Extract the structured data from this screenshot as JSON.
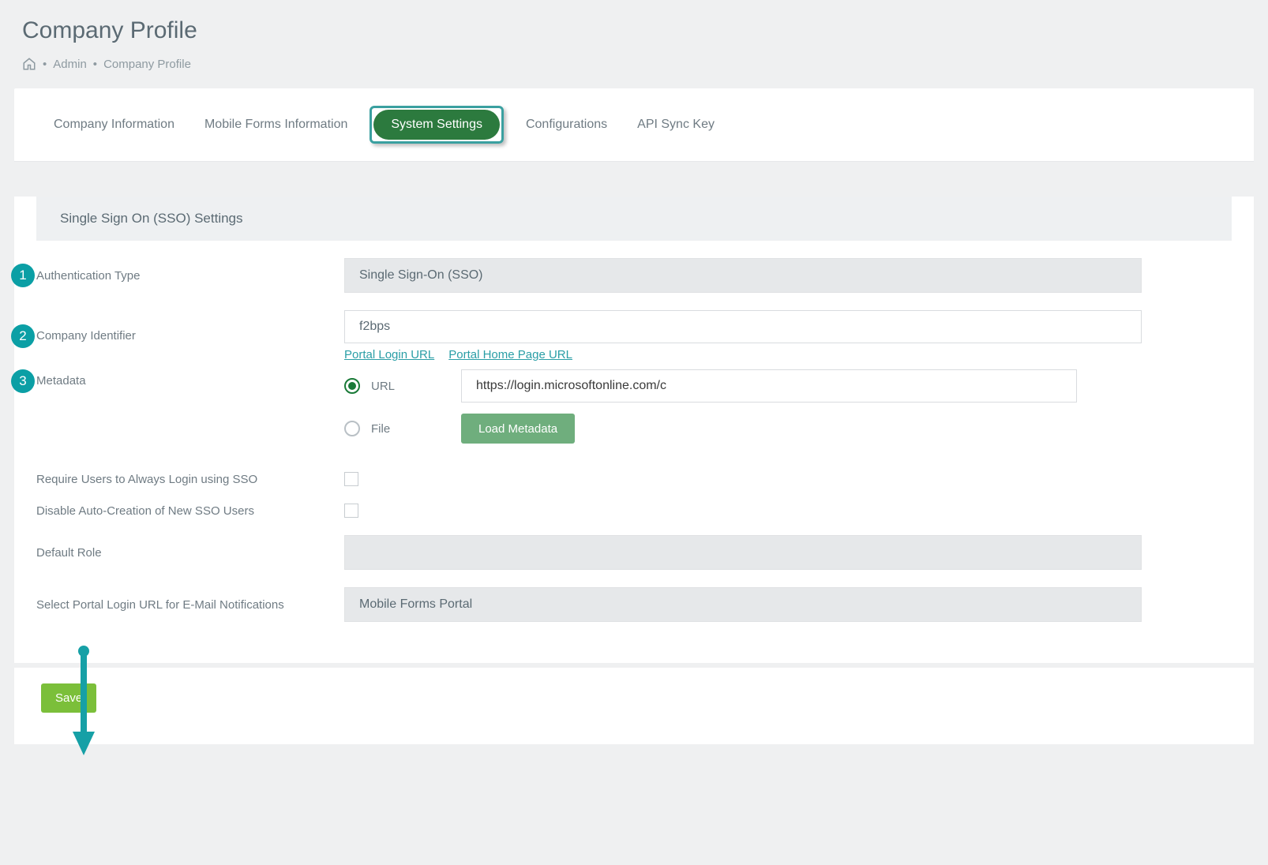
{
  "page": {
    "title": "Company Profile"
  },
  "breadcrumb": {
    "admin": "Admin",
    "current": "Company Profile"
  },
  "tabs": {
    "company_info": "Company Information",
    "mobile_forms_info": "Mobile Forms Information",
    "system_settings": "System Settings",
    "configurations": "Configurations",
    "api_sync_key": "API Sync Key"
  },
  "section": {
    "title": "Single Sign On (SSO) Settings"
  },
  "fields": {
    "auth_type_label": "Authentication Type",
    "auth_type_value": "Single Sign-On (SSO)",
    "company_identifier_label": "Company Identifier",
    "company_identifier_value": "f2bps",
    "portal_login_url_link": "Portal Login URL",
    "portal_home_url_link": "Portal Home Page URL",
    "metadata_label": "Metadata",
    "metadata_option_url": "URL",
    "metadata_option_file": "File",
    "metadata_url_value": "https://login.microsoftonline.com/c",
    "load_metadata_btn": "Load Metadata",
    "require_sso_label": "Require Users to Always Login using SSO",
    "disable_autocreate_label": "Disable Auto-Creation of New SSO Users",
    "default_role_label": "Default Role",
    "default_role_value": "",
    "select_portal_login_label": "Select Portal Login URL for E-Mail Notifications",
    "select_portal_login_value": "Mobile Forms Portal"
  },
  "annotations": {
    "badge1": "1",
    "badge2": "2",
    "badge3": "3"
  },
  "buttons": {
    "save": "Save"
  }
}
